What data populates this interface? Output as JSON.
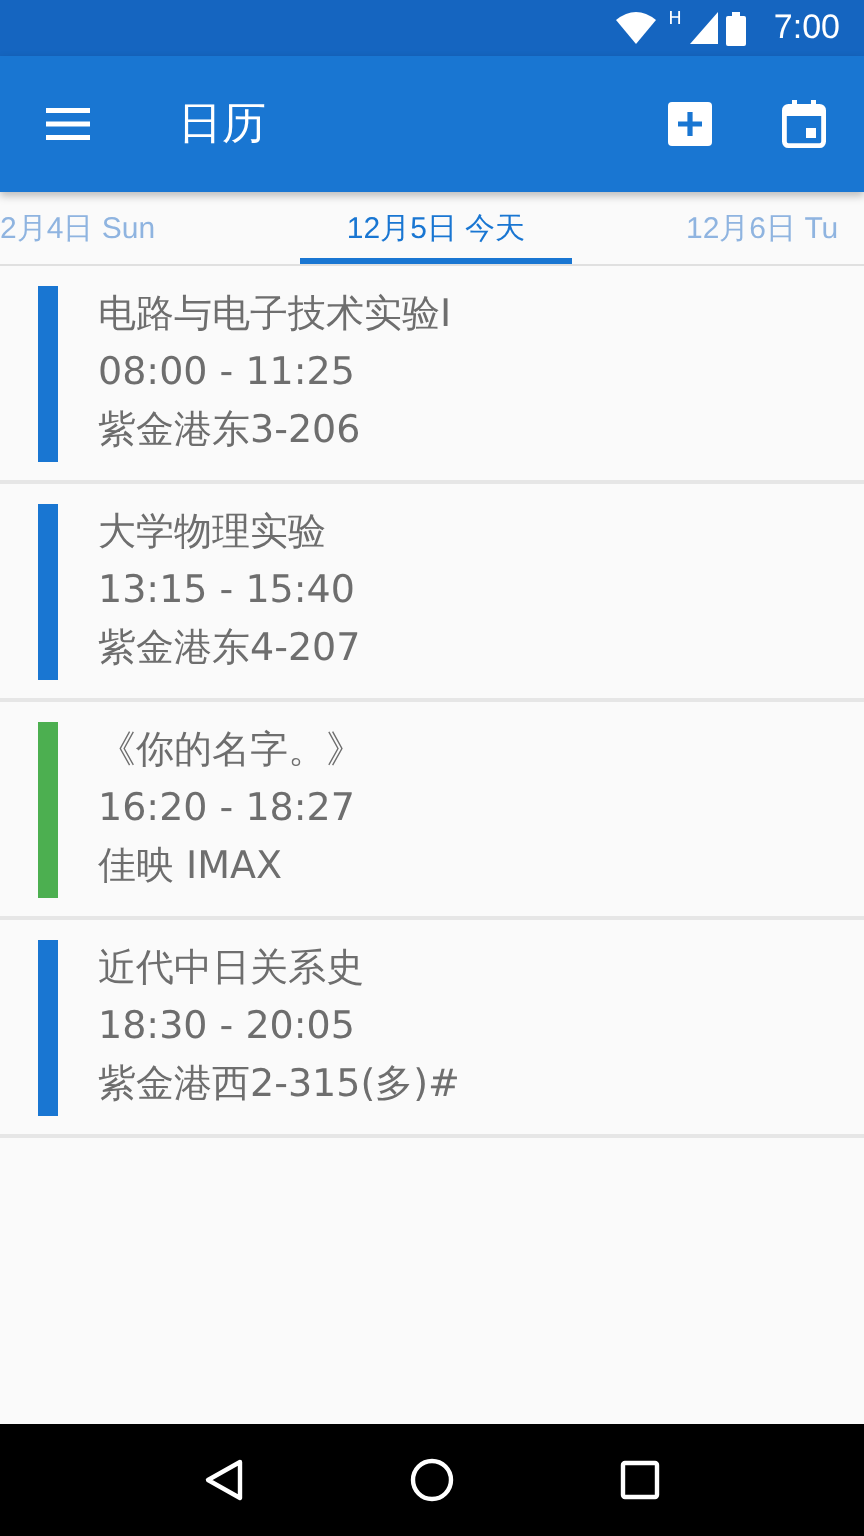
{
  "status_bar": {
    "time": "7:00",
    "network": "H"
  },
  "app_bar": {
    "title": "日历"
  },
  "tabs": [
    {
      "label": "2月4日 Sun",
      "selected": false
    },
    {
      "label": "12月5日 今天",
      "selected": true
    },
    {
      "label": "12月6日 Tu",
      "selected": false
    }
  ],
  "events": [
    {
      "title": "电路与电子技术实验I",
      "time": "08:00 - 11:25",
      "location": "紫金港东3-206",
      "color": "#1976d2"
    },
    {
      "title": "大学物理实验",
      "time": "13:15 - 15:40",
      "location": "紫金港东4-207",
      "color": "#1976d2"
    },
    {
      "title": "《你的名字。》",
      "time": "16:20 - 18:27",
      "location": "佳映 IMAX",
      "color": "#4caf50"
    },
    {
      "title": "近代中日关系史",
      "time": "18:30 - 20:05",
      "location": "紫金港西2-315(多)#",
      "color": "#1976d2"
    }
  ]
}
